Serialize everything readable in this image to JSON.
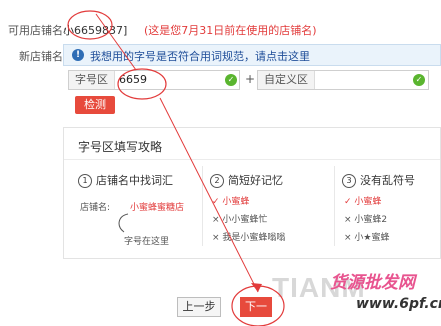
{
  "current_name": {
    "label": "可用店铺名:",
    "value": "小6659837]",
    "note": "(这是您7月31日前在使用的店铺名)"
  },
  "new_name": {
    "label": "新店铺名:"
  },
  "notice": {
    "icon": "info-icon",
    "text": "我想用的字号是否符合用词规范，请点击这里"
  },
  "field1": {
    "prefix": "字号区",
    "value": "6659"
  },
  "plus": "+",
  "field2": {
    "prefix": "自定义区",
    "value": ""
  },
  "check_button": "检测",
  "guide": {
    "title": "字号区填写攻略",
    "cols": [
      {
        "num": "1",
        "title": "店铺名中找词汇",
        "items": [
          "店铺名:",
          "小蜜蜂蜜糖店",
          "字号在这里"
        ]
      },
      {
        "num": "2",
        "title": "简短好记忆",
        "items": [
          "✓ 小蜜蜂",
          "× 小小蜜蜂忙",
          "× 我是小蜜蜂嗡嗡"
        ]
      },
      {
        "num": "3",
        "title": "没有乱符号",
        "items": [
          "✓ 小蜜蜂",
          "× 小蜜蜂2",
          "× 小★蜜蜂"
        ]
      }
    ]
  },
  "prev_button": "上一步",
  "next_button": "下一",
  "watermark": {
    "left": "TIANM",
    "brand": "货源批发网",
    "url": "www.6pf.cn"
  },
  "colors": {
    "accent": "#e74a3c",
    "ok": "#5ab52f",
    "notice_bg": "#eaf3fb",
    "annotation": "#e23b3b"
  }
}
